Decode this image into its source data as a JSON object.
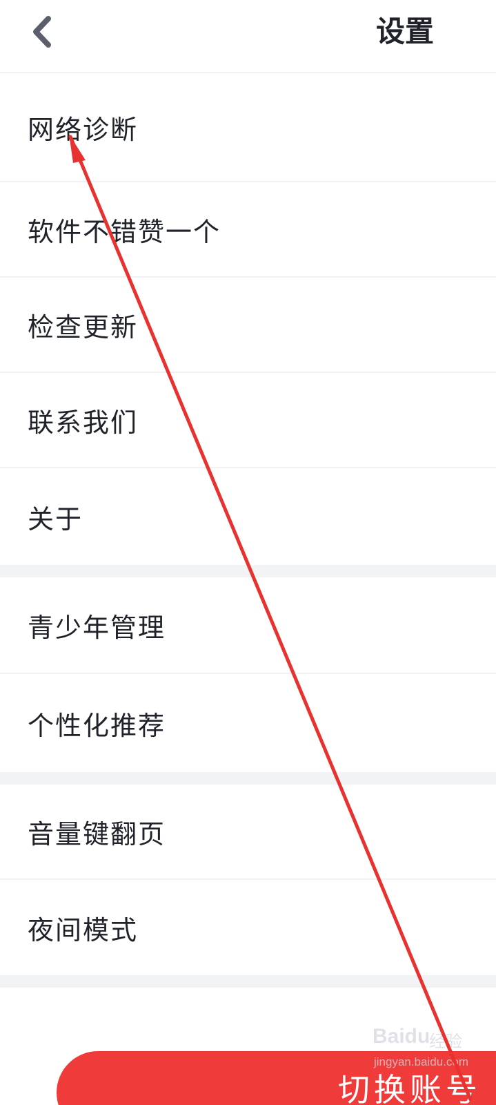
{
  "header": {
    "title": "设置"
  },
  "menu": {
    "group1": [
      "网络诊断",
      "软件不错赞一个",
      "检查更新",
      "联系我们",
      "关于"
    ],
    "group2": [
      "青少年管理",
      "个性化推荐"
    ],
    "group3": [
      "音量键翻页",
      "夜间模式"
    ]
  },
  "switch_account": {
    "label": "切换账号"
  },
  "watermark": {
    "brand": "Baidu",
    "cn": "经验",
    "url": "jingyan.baidu.com"
  },
  "colors": {
    "accent": "#ef3b3a",
    "annotation_arrow": "#e8322f",
    "text": "#1f2229",
    "divider": "#f1f1f3",
    "section_gap": "#f2f3f5"
  }
}
